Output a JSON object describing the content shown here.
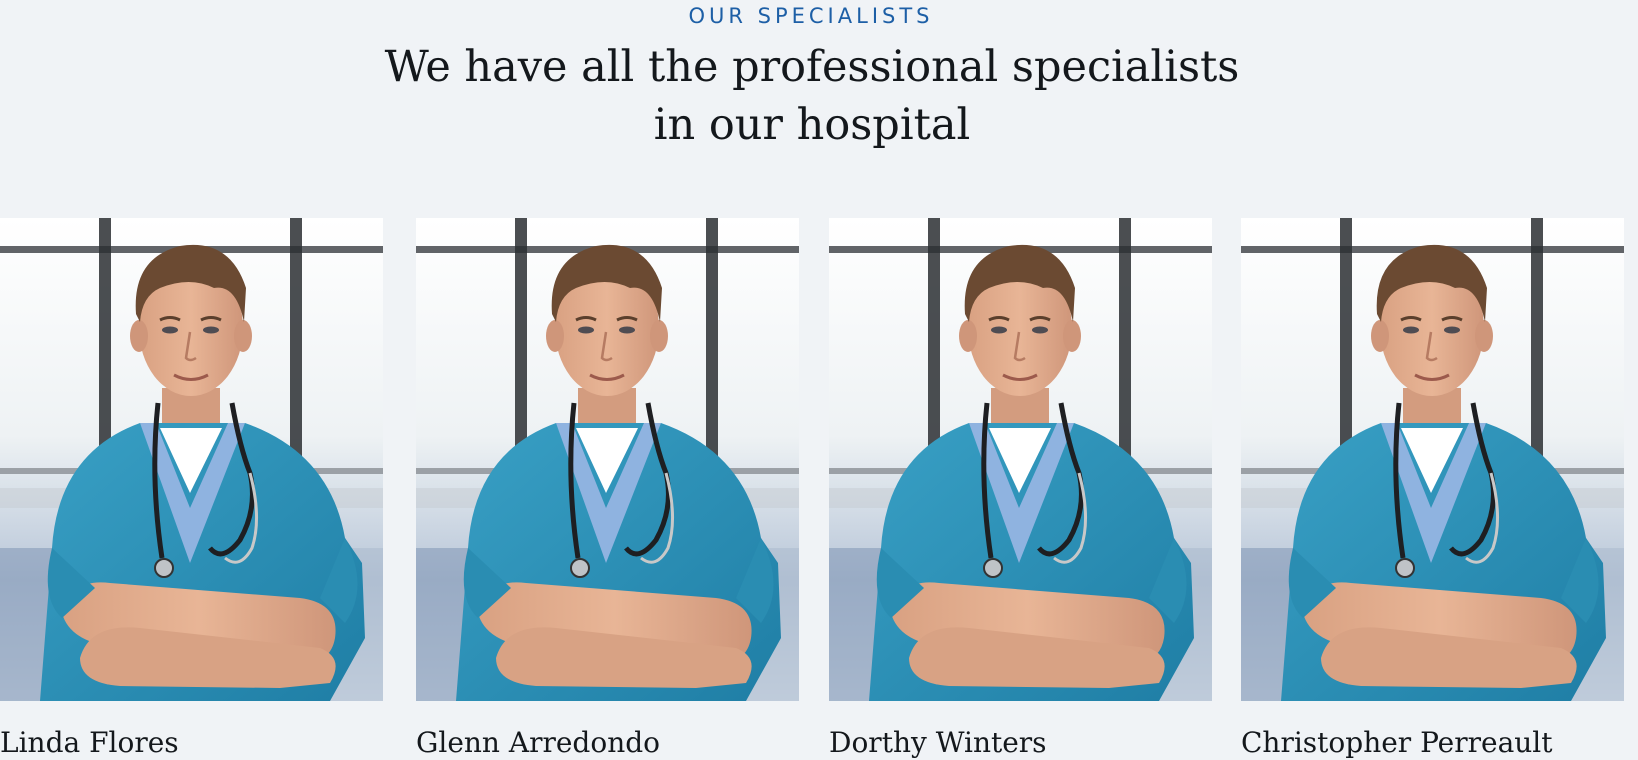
{
  "section": {
    "eyebrow": "OUR SPECIALISTS",
    "headline_line1": "We have all the professional specialists",
    "headline_line2": "in our hospital"
  },
  "specialists": [
    {
      "name": "Glenn Arredondo",
      "photo_icon": "doctor-photo"
    },
    {
      "name": "Dorthy Winters",
      "photo_icon": "doctor-photo"
    },
    {
      "name": "Christopher Perreault",
      "photo_icon": "doctor-photo"
    },
    {
      "name": "Linda Flores",
      "photo_icon": "doctor-photo"
    }
  ],
  "colors": {
    "background": "#f0f3f6",
    "accent": "#1d5fa6",
    "text": "#14181c",
    "scrubs": "#2a8db2"
  }
}
